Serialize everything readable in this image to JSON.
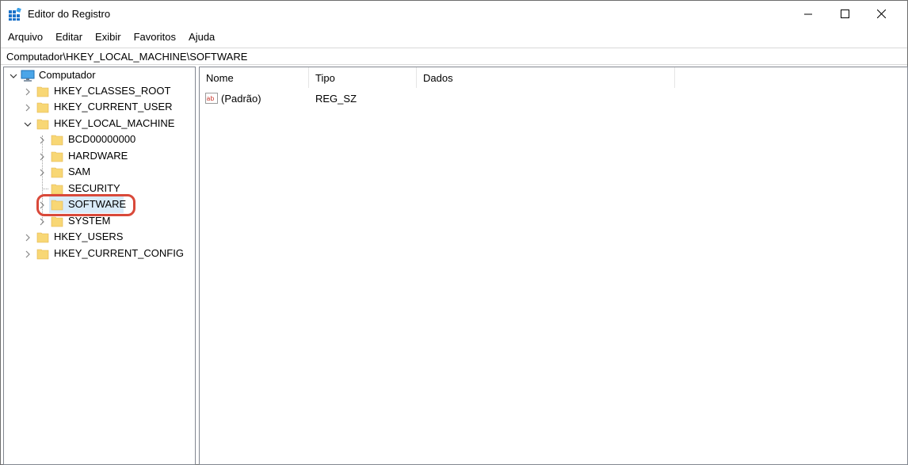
{
  "window": {
    "title": "Editor do Registro"
  },
  "menu": [
    "Arquivo",
    "Editar",
    "Exibir",
    "Favoritos",
    "Ajuda"
  ],
  "address": "Computador\\HKEY_LOCAL_MACHINE\\SOFTWARE",
  "tree": {
    "root": "Computador",
    "hives": [
      "HKEY_CLASSES_ROOT",
      "HKEY_CURRENT_USER",
      "HKEY_LOCAL_MACHINE",
      "HKEY_USERS",
      "HKEY_CURRENT_CONFIG"
    ],
    "hklm_children": [
      "BCD00000000",
      "HARDWARE",
      "SAM",
      "SECURITY",
      "SOFTWARE",
      "SYSTEM"
    ],
    "selected": "SOFTWARE"
  },
  "list": {
    "columns": [
      "Nome",
      "Tipo",
      "Dados"
    ],
    "rows": [
      {
        "name": "(Padrão)",
        "type": "REG_SZ",
        "data": ""
      }
    ]
  },
  "colors": {
    "selection": "#d9ebf9",
    "highlight_ring": "#d9493a",
    "folder": "#f8d775"
  }
}
